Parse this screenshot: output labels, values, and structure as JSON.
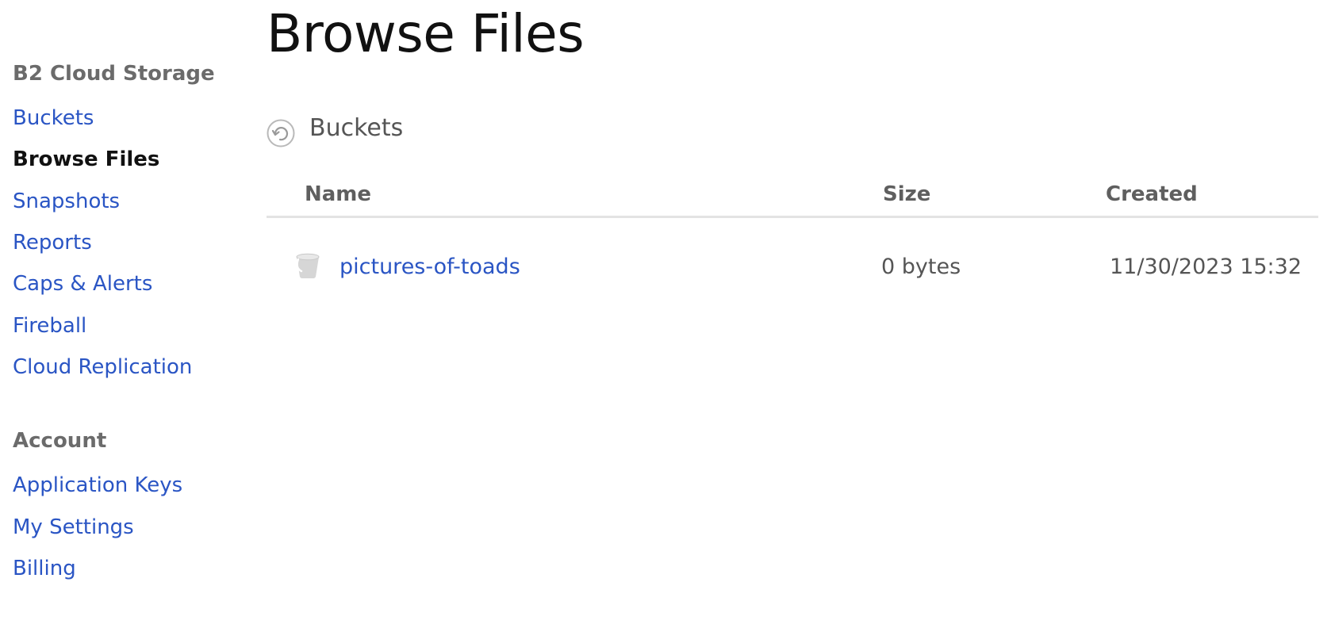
{
  "sidebar": {
    "sections": [
      {
        "heading": "B2 Cloud Storage",
        "items": [
          {
            "label": "Buckets"
          },
          {
            "label": "Browse Files"
          },
          {
            "label": "Snapshots"
          },
          {
            "label": "Reports"
          },
          {
            "label": "Caps & Alerts"
          },
          {
            "label": "Fireball"
          },
          {
            "label": "Cloud Replication"
          }
        ]
      },
      {
        "heading": "Account",
        "items": [
          {
            "label": "Application Keys"
          },
          {
            "label": "My Settings"
          },
          {
            "label": "Billing"
          }
        ]
      }
    ],
    "active_item": "Browse Files"
  },
  "main": {
    "title": "Browse Files",
    "breadcrumb": {
      "icon": "back-circle-arrow-icon",
      "label": "Buckets"
    },
    "table": {
      "columns": [
        "Name",
        "Size",
        "Created"
      ],
      "rows": [
        {
          "icon": "bucket-icon",
          "name": "pictures-of-toads",
          "size": "0 bytes",
          "created": "11/30/2023 15:32"
        }
      ]
    }
  },
  "colors": {
    "link": "#2a55c4",
    "heading": "#6b6b6b",
    "active": "#111111",
    "divider": "#e3e3e3"
  }
}
